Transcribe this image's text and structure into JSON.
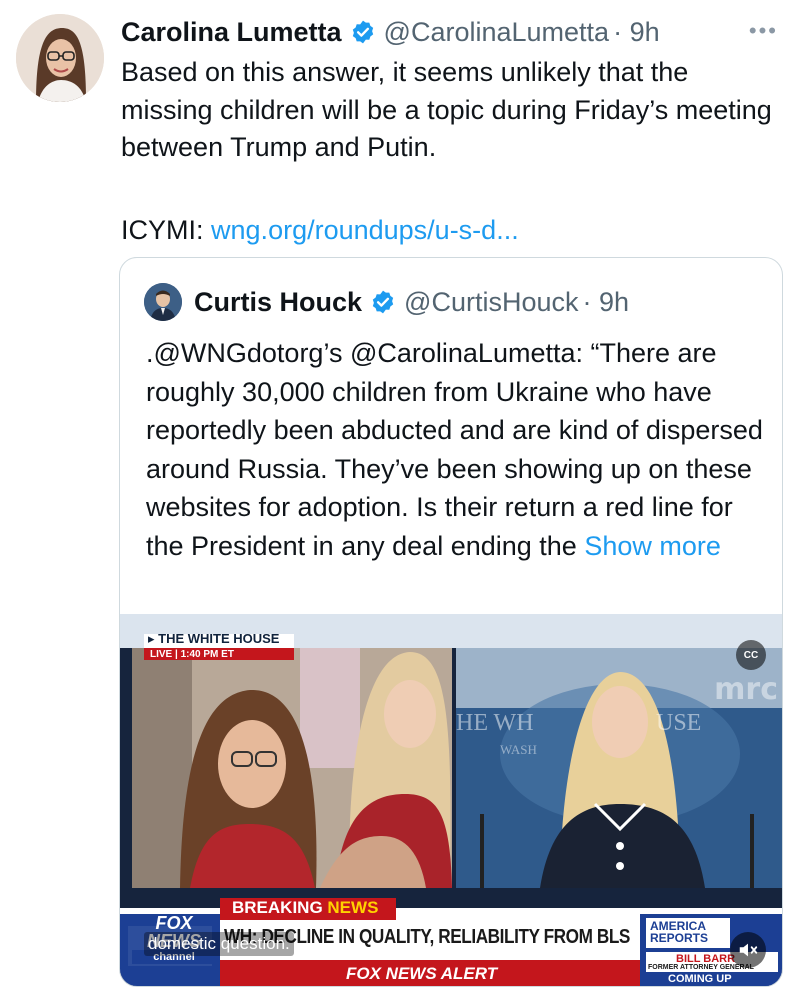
{
  "tweet": {
    "author_name": "Carolina Lumetta",
    "author_handle": "@CarolinaLumetta",
    "time": "· 9h",
    "more_label": "•••",
    "text": "Based on this answer, it seems unlikely that the missing children will be a topic during Friday’s meeting between Trump and Putin.",
    "icymi_label": "ICYMI:",
    "link_text": "wng.org/roundups/u-s-d..."
  },
  "quote": {
    "author_name": "Curtis Houck",
    "author_handle": "@CurtisHouck",
    "time": "· 9h",
    "text": ".@WNGdotorg’s @CarolinaLumetta: “There are roughly 30,000 children from Ukraine who have reportedly been abducted and are kind of dispersed around Russia. They’ve been showing up on these websites for adoption. Is their return a red line for the President in any deal ending the",
    "show_more": "Show more"
  },
  "video": {
    "location_label": "▸ THE WHITE HOUSE",
    "live_label": "LIVE",
    "live_time": "1:40 PM ET",
    "breaking_label": "BREAKING",
    "breaking_news_label": "NEWS",
    "headline": "WH: DECLINE IN QUALITY, RELIABILITY FROM BLS",
    "alert": "FOX NEWS ALERT",
    "network_top": "FOX",
    "network_bottom": "NEWS",
    "network_channel": "channel",
    "show_name_1": "AMERICA",
    "show_name_2": "REPORTS",
    "guest_name": "BILL BARR",
    "guest_title": "FORMER ATTORNEY GENERAL",
    "coming_up": "COMING UP",
    "watermark": "mrc",
    "podium_text_left": "HE WH",
    "podium_text_right": "USE",
    "podium_sub": "WASH",
    "cc_label": "CC",
    "caption": "domestic question."
  },
  "colors": {
    "link": "#1d9bf0",
    "verified": "#1d9bf0",
    "fox_red": "#c4161c",
    "fox_blue": "#1c3f94"
  }
}
